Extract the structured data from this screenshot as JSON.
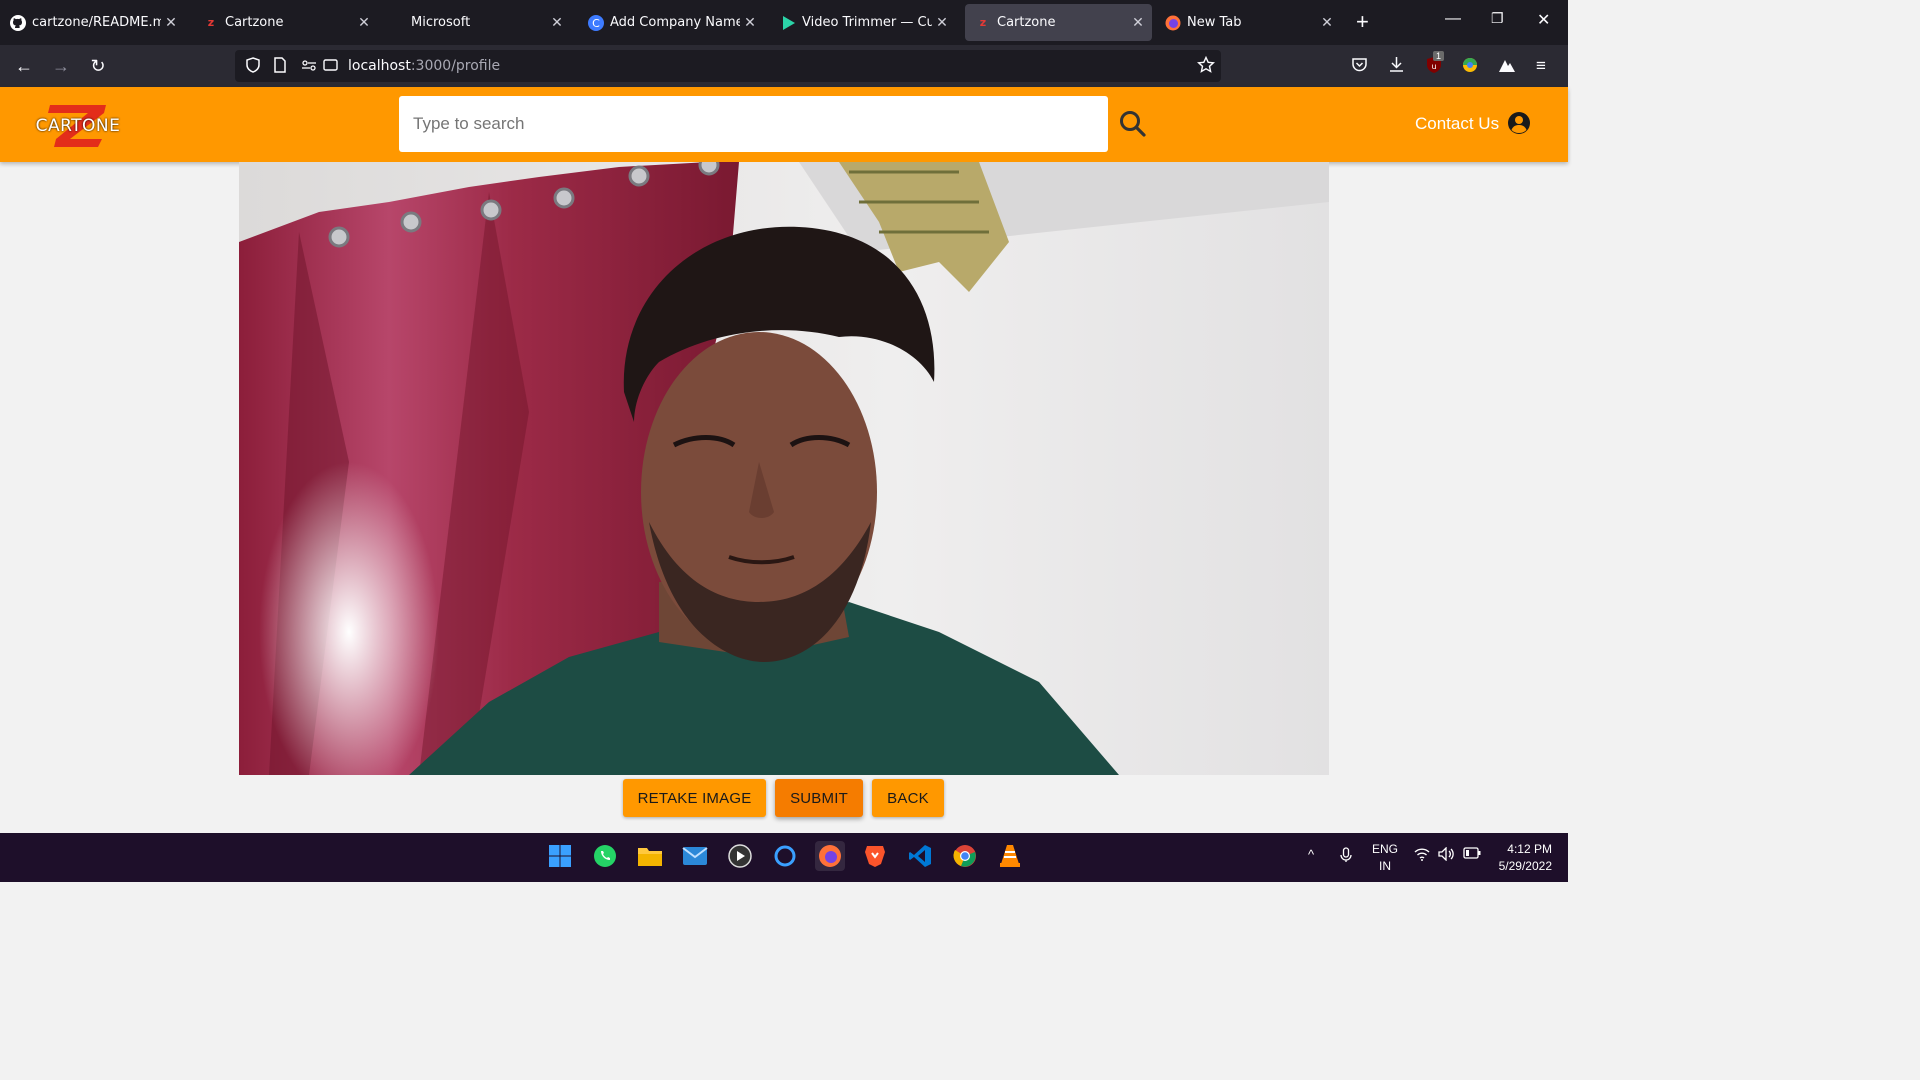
{
  "browser": {
    "tabs": [
      {
        "title": "cartzone/README.md at",
        "icon": "github-icon",
        "active": false
      },
      {
        "title": "Cartzone",
        "icon": "cartzone-icon",
        "active": false
      },
      {
        "title": "Microsoft",
        "icon": "",
        "active": false
      },
      {
        "title": "Add Company Name",
        "icon": "canva-icon",
        "active": false
      },
      {
        "title": "Video Trimmer — Cut Vi",
        "icon": "play-icon",
        "active": false
      },
      {
        "title": "Cartzone",
        "icon": "cartzone-icon",
        "active": true
      },
      {
        "title": "New Tab",
        "icon": "firefox-icon",
        "active": false
      }
    ],
    "url_host": "localhost",
    "url_path": ":3000/profile",
    "extension_badge": "1"
  },
  "header": {
    "logo_text": "CARTONE",
    "search_placeholder": "Type to search",
    "contact_label": "Contact Us"
  },
  "actions": {
    "retake_label": "RETAKE IMAGE",
    "submit_label": "SUBMIT",
    "back_label": "BACK"
  },
  "taskbar": {
    "lang_line1": "ENG",
    "lang_line2": "IN",
    "time": "4:12 PM",
    "date": "5/29/2022"
  },
  "colors": {
    "accent": "#ff9800",
    "button_active": "#f57c00",
    "tab_bg": "#1c1b22",
    "nav_bg": "#2b2a33"
  }
}
